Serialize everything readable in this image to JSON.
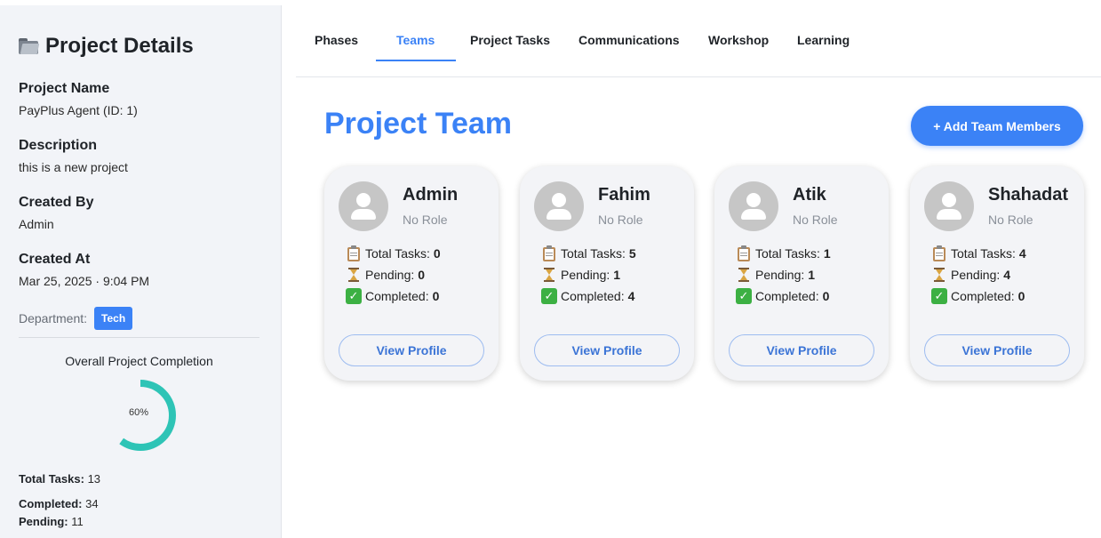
{
  "sidebar": {
    "title": "Project Details",
    "project_name_label": "Project Name",
    "project_name_value": "PayPlus Agent (ID: 1)",
    "description_label": "Description",
    "description_value": "this is a new project",
    "created_by_label": "Created By",
    "created_by_value": "Admin",
    "created_at_label": "Created At",
    "created_at_value": "Mar 25, 2025 · 9:04 PM",
    "department_label": "Department:",
    "department_value": "Tech",
    "completion_title": "Overall Project Completion",
    "completion_percent_label": "60%",
    "completion_fraction": 0.6,
    "total_tasks_label": "Total Tasks:",
    "total_tasks_value": "13",
    "completed_label": "Completed:",
    "completed_value": "34",
    "pending_label": "Pending:",
    "pending_value": "11"
  },
  "tabs": [
    {
      "label": "Phases",
      "active": false
    },
    {
      "label": "Teams",
      "active": true
    },
    {
      "label": "Project Tasks",
      "active": false
    },
    {
      "label": "Communications",
      "active": false
    },
    {
      "label": "Workshop",
      "active": false
    },
    {
      "label": "Learning",
      "active": false
    }
  ],
  "main": {
    "title": "Project Team",
    "add_button_label": "+ Add Team Members"
  },
  "team": [
    {
      "name": "Admin",
      "role": "No Role",
      "total_label": "Total Tasks:",
      "total": "0",
      "pending_label": "Pending:",
      "pending": "0",
      "completed_label": "Completed:",
      "completed": "0",
      "button": "View Profile"
    },
    {
      "name": "Fahim",
      "role": "No Role",
      "total_label": "Total Tasks:",
      "total": "5",
      "pending_label": "Pending:",
      "pending": "1",
      "completed_label": "Completed:",
      "completed": "4",
      "button": "View Profile"
    },
    {
      "name": "Atik",
      "role": "No Role",
      "total_label": "Total Tasks:",
      "total": "1",
      "pending_label": "Pending:",
      "pending": "1",
      "completed_label": "Completed:",
      "completed": "0",
      "button": "View Profile"
    },
    {
      "name": "Shahadat",
      "role": "No Role",
      "total_label": "Total Tasks:",
      "total": "4",
      "pending_label": "Pending:",
      "pending": "4",
      "completed_label": "Completed:",
      "completed": "0",
      "button": "View Profile"
    }
  ],
  "colors": {
    "accent": "#3b82f6",
    "donut": "#2ec4b6",
    "sidebar_bg": "#f2f4f8"
  },
  "icons": {
    "title": "folder-icon",
    "total": "clipboard-icon",
    "pending": "hourglass-icon",
    "completed": "check-mark-icon",
    "avatar": "user-avatar-icon"
  }
}
